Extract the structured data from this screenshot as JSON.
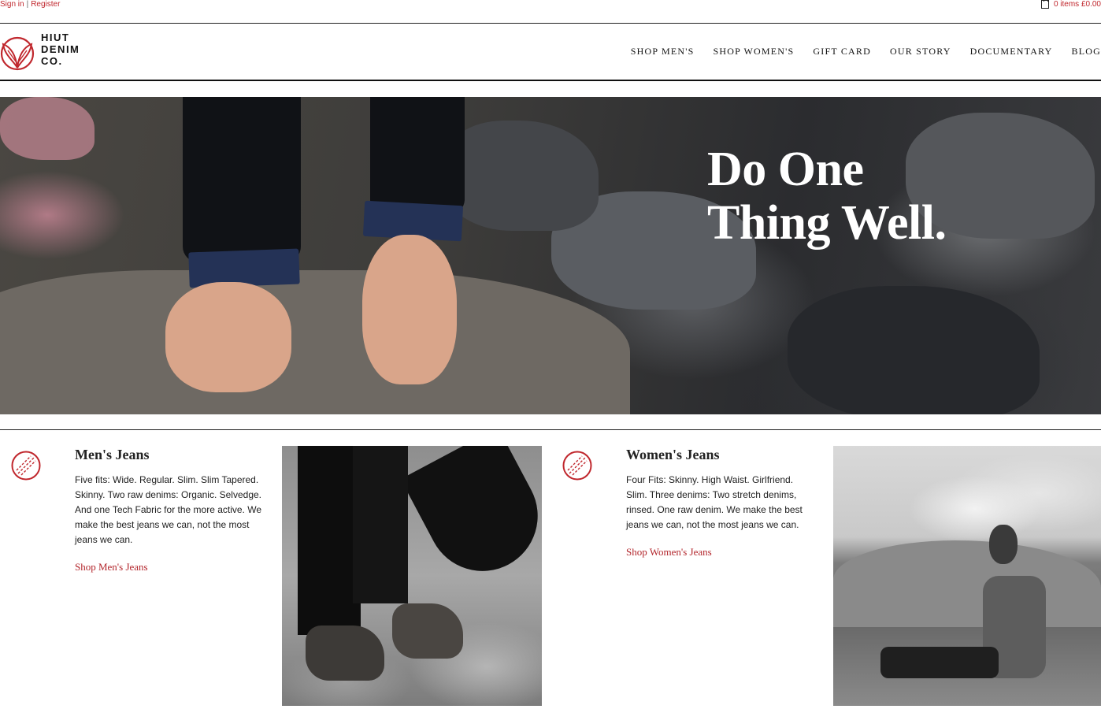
{
  "utility": {
    "sign_in": "Sign in",
    "separator": "|",
    "register": "Register",
    "cart": "0 items £0.00"
  },
  "brand": {
    "line1": "HIUT",
    "line2": "DENIM",
    "line3": "CO.",
    "accent_color": "#c0272d"
  },
  "nav": {
    "items": [
      {
        "label": "SHOP MEN'S"
      },
      {
        "label": "SHOP WOMEN'S"
      },
      {
        "label": "GIFT CARD"
      },
      {
        "label": "OUR STORY"
      },
      {
        "label": "DOCUMENTARY"
      },
      {
        "label": "BLOG"
      }
    ]
  },
  "hero": {
    "headline_line1": "Do One",
    "headline_line2": "Thing Well."
  },
  "cards": [
    {
      "title": "Men's Jeans",
      "text": "Five fits: Wide. Regular. Slim. Slim Tapered. Skinny. Two raw denims: Organic. Selvedge. And one Tech Fabric for the more active. We make the best jeans we can, not the most jeans we can.",
      "link": "Shop Men's Jeans",
      "icon": "stitched-ball-icon"
    },
    {
      "title": "Women's Jeans",
      "text": "Four Fits: Skinny. High Waist. Girlfriend. Slim. Three denims: Two stretch denims, rinsed. One raw denim. We make the best jeans we can, not the most jeans we can.",
      "link": "Shop Women's Jeans",
      "icon": "stitched-ball-icon"
    }
  ]
}
